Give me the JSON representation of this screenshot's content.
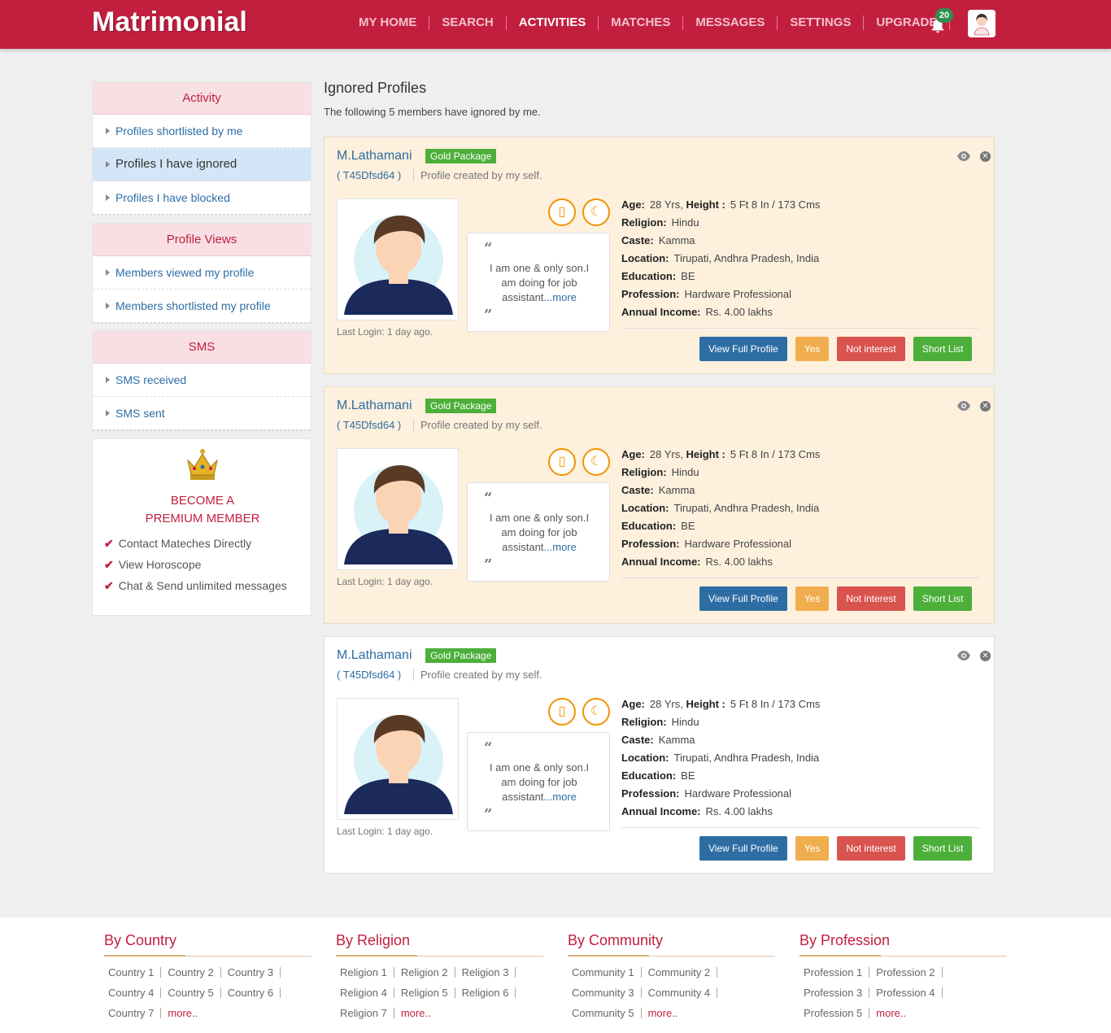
{
  "header": {
    "logo": "Matrimonial",
    "nav": [
      "MY HOME",
      "SEARCH",
      "ACTIVITIES",
      "MATCHES",
      "MESSAGES",
      "SETTINGS",
      "UPGRADE"
    ],
    "active_nav": "ACTIVITIES",
    "notification_count": "20",
    "brand_color": "#c21f3f"
  },
  "sidebar": {
    "activity": {
      "title": "Activity",
      "items": [
        "Profiles shortlisted by me",
        "Profiles I have ignored",
        "Profiles I have blocked"
      ],
      "active_index": 1
    },
    "profile_views": {
      "title": "Profile Views",
      "items": [
        "Members viewed my profile",
        "Members shortlisted my profile"
      ]
    },
    "sms": {
      "title": "SMS",
      "items": [
        "SMS received",
        "SMS sent"
      ]
    },
    "premium": {
      "title_line1": "BECOME A",
      "title_line2": "PREMIUM MEMBER",
      "benefits": [
        "Contact Mateches Directly",
        "View Horoscope",
        "Chat & Send unlimited messages"
      ]
    }
  },
  "main": {
    "title": "Ignored Profiles",
    "subtitle": "The following 5 members have ignored by me.",
    "profiles": [
      {
        "name": "M.Lathamani",
        "package": "Gold Package",
        "id": "( T45Dfsd64 )",
        "created_by": "Profile created by my self.",
        "about": "I am one & only son.I am doing for job assistant",
        "more": "...more",
        "last_login": "Last Login: 1 day ago.",
        "details": {
          "age_label": "Age:",
          "age": "28 Yrs,",
          "height_label": "Height :",
          "height": "5 Ft 8 In / 173 Cms",
          "religion_label": "Religion:",
          "religion": "Hindu",
          "caste_label": "Caste:",
          "caste": "Kamma",
          "location_label": "Location:",
          "location": "Tirupati, Andhra Pradesh, India",
          "education_label": "Education:",
          "education": "BE",
          "profession_label": "Profession:",
          "profession": "Hardware Professional",
          "income_label": "Annual Income:",
          "income": "Rs. 4.00 lakhs"
        }
      },
      {
        "name": "M.Lathamani",
        "package": "Gold Package",
        "id": "( T45Dfsd64 )",
        "created_by": "Profile created by my self.",
        "about": "I am one & only son.I am doing for job assistant",
        "more": "...more",
        "last_login": "Last Login: 1 day ago.",
        "details": {
          "age_label": "Age:",
          "age": "28 Yrs,",
          "height_label": "Height :",
          "height": "5 Ft 8 In / 173 Cms",
          "religion_label": "Religion:",
          "religion": "Hindu",
          "caste_label": "Caste:",
          "caste": "Kamma",
          "location_label": "Location:",
          "location": "Tirupati, Andhra Pradesh, India",
          "education_label": "Education:",
          "education": "BE",
          "profession_label": "Profession:",
          "profession": "Hardware Professional",
          "income_label": "Annual Income:",
          "income": "Rs. 4.00 lakhs"
        }
      },
      {
        "name": "M.Lathamani",
        "package": "Gold Package",
        "id": "( T45Dfsd64 )",
        "created_by": "Profile created by my self.",
        "about": "I am one & only son.I am doing for job assistant",
        "more": "...more",
        "last_login": "Last Login: 1 day ago.",
        "details": {
          "age_label": "Age:",
          "age": "28 Yrs,",
          "height_label": "Height :",
          "height": "5 Ft 8 In / 173 Cms",
          "religion_label": "Religion:",
          "religion": "Hindu",
          "caste_label": "Caste:",
          "caste": "Kamma",
          "location_label": "Location:",
          "location": "Tirupati, Andhra Pradesh, India",
          "education_label": "Education:",
          "education": "BE",
          "profession_label": "Profession:",
          "profession": "Hardware Professional",
          "income_label": "Annual Income:",
          "income": "Rs. 4.00 lakhs"
        }
      }
    ],
    "buttons": {
      "view": "View Full Profile",
      "yes": "Yes",
      "not_interest": "Not interest",
      "short_list": "Short List"
    }
  },
  "footer": {
    "columns": [
      {
        "title": "By Country",
        "rows": [
          [
            "Country 1",
            "Country 2",
            "Country 3"
          ],
          [
            "Country 4",
            "Country 5",
            "Country 6"
          ],
          [
            "Country 7",
            "more.."
          ]
        ]
      },
      {
        "title": "By Religion",
        "rows": [
          [
            "Religion 1",
            "Religion 2",
            "Religion 3"
          ],
          [
            "Religion 4",
            "Religion 5",
            "Religion 6"
          ],
          [
            "Religion 7",
            "more.."
          ]
        ]
      },
      {
        "title": "By Community",
        "rows": [
          [
            "Community 1",
            "Community 2"
          ],
          [
            "Community 3",
            "Community 4"
          ],
          [
            "Community 5",
            "more.."
          ]
        ]
      },
      {
        "title": "By Profession",
        "rows": [
          [
            "Profession 1",
            "Profession 2"
          ],
          [
            "Profession 3",
            "Profession 4"
          ],
          [
            "Profession 5",
            "more.."
          ]
        ]
      }
    ]
  },
  "icons": [
    "bell-icon",
    "user-avatar-icon",
    "eye-icon",
    "close-icon",
    "mobile-icon",
    "horoscope-icon",
    "crown-icon",
    "check-icon",
    "quote-open-icon",
    "quote-close-icon"
  ]
}
